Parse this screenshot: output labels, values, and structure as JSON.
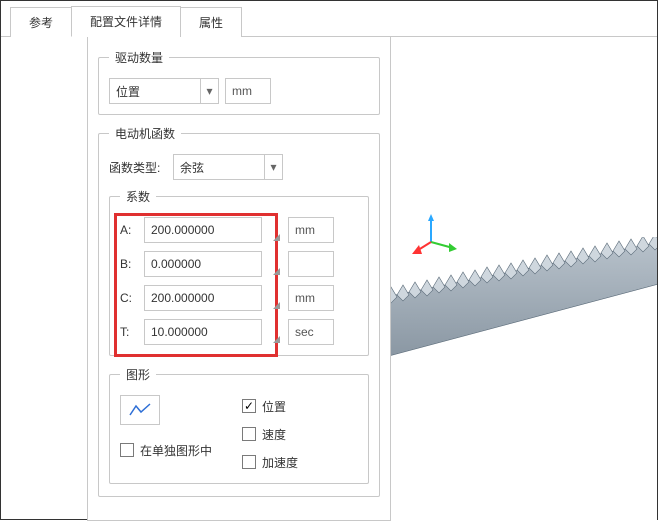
{
  "tabs": {
    "ref": "参考",
    "profile": "配置文件详情",
    "attr": "属性"
  },
  "drive": {
    "legend": "驱动数量",
    "type": "位置",
    "unit": "mm"
  },
  "motor": {
    "legend": "电动机函数",
    "fn_label": "函数类型:",
    "fn_value": "余弦"
  },
  "coeff": {
    "legend": "系数",
    "A": {
      "label": "A:",
      "value": "200.000000",
      "unit": "mm"
    },
    "B": {
      "label": "B:",
      "value": "0.000000",
      "unit": ""
    },
    "C": {
      "label": "C:",
      "value": "200.000000",
      "unit": "mm"
    },
    "T": {
      "label": "T:",
      "value": "10.000000",
      "unit": "sec"
    }
  },
  "graph": {
    "legend": "图形",
    "separate": "在单独图形中",
    "pos": "位置",
    "vel": "速度",
    "acc": "加速度"
  }
}
